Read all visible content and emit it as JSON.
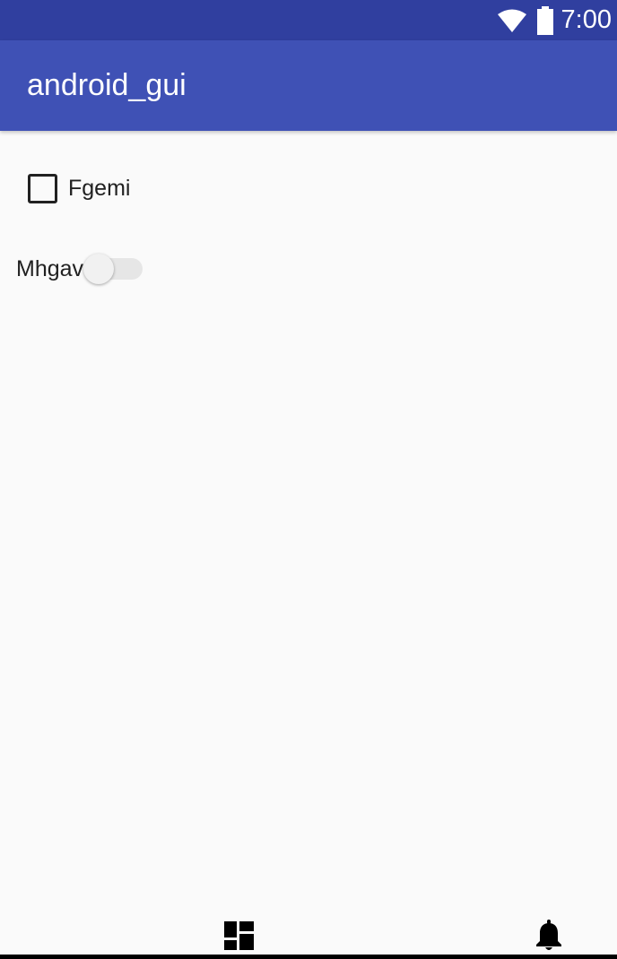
{
  "status_bar": {
    "time": "7:00",
    "icons": [
      "wifi-icon",
      "battery-icon"
    ],
    "color": "#303f9f"
  },
  "app_bar": {
    "title": "android_gui",
    "color": "#3f51b5"
  },
  "content": {
    "checkbox": {
      "label": "Fgemi",
      "checked": false
    },
    "switch": {
      "label": "Mhgav",
      "on": false
    }
  },
  "bottom_nav": {
    "icons": [
      "dashboard-icon",
      "notifications-bell-icon"
    ]
  }
}
